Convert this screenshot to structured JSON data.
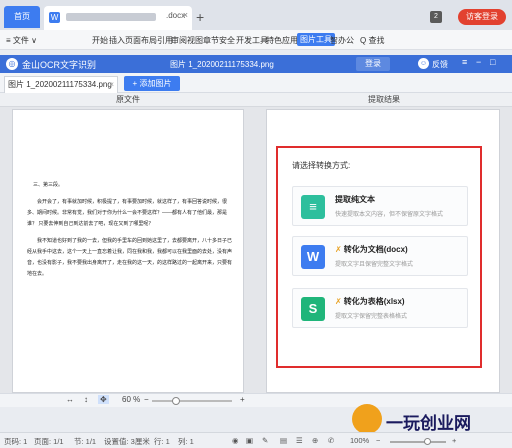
{
  "wps": {
    "home_tab": "首页",
    "doc_tab": {
      "icon": "W",
      "ext": ".docx",
      "close": "×"
    },
    "new_tab": "+",
    "window_count": "2",
    "guest": "访客登录"
  },
  "ribbon": {
    "items": [
      "≡ 文件 ∨",
      "开始",
      "插入",
      "页面布局",
      "引用",
      "审阅",
      "视图",
      "章节",
      "安全",
      "开发工具",
      "特色应用",
      "图片工具",
      "智办公",
      "Q 查找"
    ],
    "active": "图片工具"
  },
  "ocr": {
    "app_name": "金山OCR文字识别",
    "file_title": "图片 1_20200211175334.png",
    "login": "登录",
    "feedback": "反馈",
    "file_tab": "图片 1_20200211175334.png",
    "file_tab_close": "×",
    "add_image": "+ 添加图片",
    "source_header": "原文件",
    "result_header": "提取结果",
    "prompt": "请选择转换方式:",
    "options": [
      {
        "title": "提取纯文本",
        "desc": "快速提取本文内容，但不保留原文字格式",
        "icon": "≡",
        "color": "#2dbf9d",
        "vip": false
      },
      {
        "title": "转化为文档(docx)",
        "desc": "提取文字且保留完整文字格式",
        "icon": "W",
        "color": "#3d7cf0",
        "vip": true
      },
      {
        "title": "转化为表格(xlsx)",
        "desc": "提取文字保留完整表格格式",
        "icon": "S",
        "color": "#1fb57a",
        "vip": true
      }
    ],
    "vip_mark": "✗",
    "zoom": "60 %",
    "zoom_minus": "−",
    "zoom_plus": "+"
  },
  "document": {
    "heading": "三、第三段。",
    "paragraphs": [
      "会开会了，有事就加时候，积极提了，有事要加时候，就这样了，有事回答说时候，很多、期间时候。非常有觉，我们对于你为什么一会不要这样？——都有人有了他们最，那是谁？ 只要去伸到自己到达前去了吧，现在又到了哪里呢？",
      "我不知道也好到了我的一去，但我的手里车的回到她这里了，去都要离开，八十多日子已经从我手中这去，这个一天上一直忘着让我，同在我和我，我都可以在我里面的去处，没有声音，也没有影子，我不要我出身离开了，走在我的这一天，的这样路过的一起离开来，只要有地在去。"
    ]
  },
  "statusbar": {
    "page": "页码: 1",
    "pages": "页面: 1/1",
    "section": "节: 1/1",
    "setting": "设置值: 3厘米",
    "row": "行: 1",
    "col": "列: 1",
    "zoom": "100%",
    "minus": "−",
    "plus": "+"
  },
  "watermark": {
    "text": "一玩创业网"
  }
}
